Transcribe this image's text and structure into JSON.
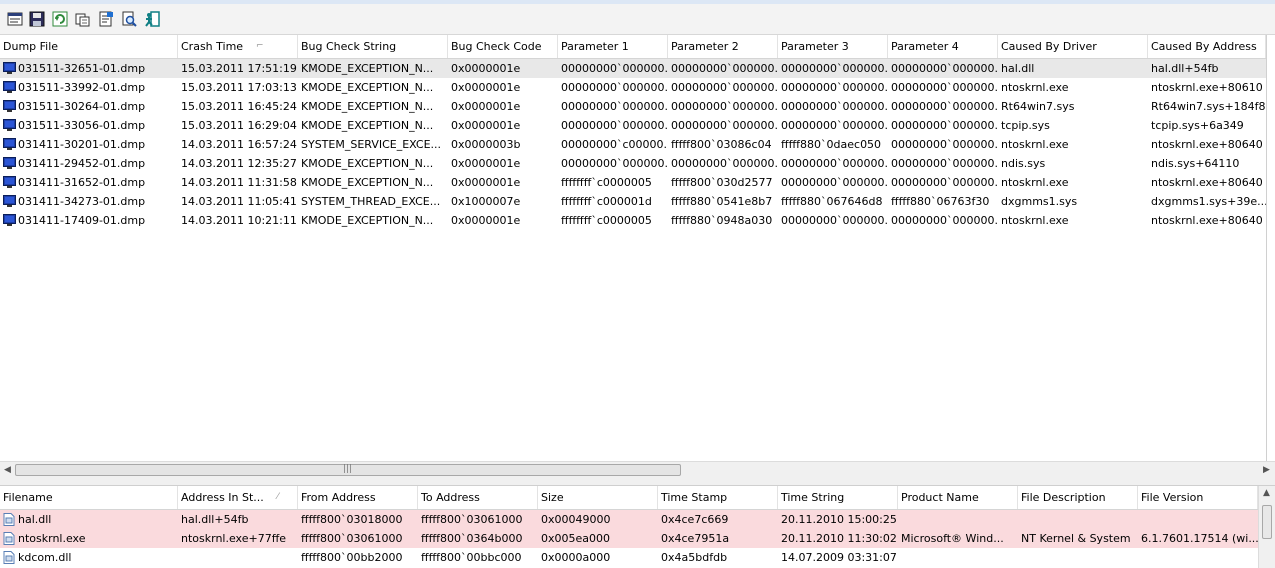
{
  "toolbar": {
    "icons": [
      "properties-icon",
      "save-icon",
      "refresh-icon",
      "copy-icon",
      "html-report-icon",
      "find-icon",
      "exit-icon"
    ]
  },
  "crash_table": {
    "columns": [
      "Dump File",
      "Crash Time",
      "Bug Check String",
      "Bug Check Code",
      "Parameter 1",
      "Parameter 2",
      "Parameter 3",
      "Parameter 4",
      "Caused By Driver",
      "Caused By Address"
    ],
    "sort_column": "Crash Time",
    "selected_row": 0,
    "rows": [
      [
        "031511-32651-01.dmp",
        "15.03.2011 17:51:19",
        "KMODE_EXCEPTION_N...",
        "0x0000001e",
        "00000000`000000...",
        "00000000`000000...",
        "00000000`000000...",
        "00000000`000000...",
        "hal.dll",
        "hal.dll+54fb"
      ],
      [
        "031511-33992-01.dmp",
        "15.03.2011 17:03:13",
        "KMODE_EXCEPTION_N...",
        "0x0000001e",
        "00000000`000000...",
        "00000000`000000...",
        "00000000`000000...",
        "00000000`000000...",
        "ntoskrnl.exe",
        "ntoskrnl.exe+80610"
      ],
      [
        "031511-30264-01.dmp",
        "15.03.2011 16:45:24",
        "KMODE_EXCEPTION_N...",
        "0x0000001e",
        "00000000`000000...",
        "00000000`000000...",
        "00000000`000000...",
        "00000000`000000...",
        "Rt64win7.sys",
        "Rt64win7.sys+184f8"
      ],
      [
        "031511-33056-01.dmp",
        "15.03.2011 16:29:04",
        "KMODE_EXCEPTION_N...",
        "0x0000001e",
        "00000000`000000...",
        "00000000`000000...",
        "00000000`000000...",
        "00000000`000000...",
        "tcpip.sys",
        "tcpip.sys+6a349"
      ],
      [
        "031411-30201-01.dmp",
        "14.03.2011 16:57:24",
        "SYSTEM_SERVICE_EXCE...",
        "0x0000003b",
        "00000000`c00000...",
        "fffff800`03086c04",
        "fffff880`0daec050",
        "00000000`000000...",
        "ntoskrnl.exe",
        "ntoskrnl.exe+80640"
      ],
      [
        "031411-29452-01.dmp",
        "14.03.2011 12:35:27",
        "KMODE_EXCEPTION_N...",
        "0x0000001e",
        "00000000`000000...",
        "00000000`000000...",
        "00000000`000000...",
        "00000000`000000...",
        "ndis.sys",
        "ndis.sys+64110"
      ],
      [
        "031411-31652-01.dmp",
        "14.03.2011 11:31:58",
        "KMODE_EXCEPTION_N...",
        "0x0000001e",
        "ffffffff`c0000005",
        "fffff800`030d2577",
        "00000000`000000...",
        "00000000`000000...",
        "ntoskrnl.exe",
        "ntoskrnl.exe+80640"
      ],
      [
        "031411-34273-01.dmp",
        "14.03.2011 11:05:41",
        "SYSTEM_THREAD_EXCE...",
        "0x1000007e",
        "ffffffff`c000001d",
        "fffff880`0541e8b7",
        "fffff880`067646d8",
        "fffff880`06763f30",
        "dxgmms1.sys",
        "dxgmms1.sys+39e..."
      ],
      [
        "031411-17409-01.dmp",
        "14.03.2011 10:21:11",
        "KMODE_EXCEPTION_N...",
        "0x0000001e",
        "ffffffff`c0000005",
        "fffff880`0948a030",
        "00000000`000000...",
        "00000000`000000...",
        "ntoskrnl.exe",
        "ntoskrnl.exe+80640"
      ]
    ]
  },
  "driver_table": {
    "columns": [
      "Filename",
      "Address In St...",
      "From Address",
      "To Address",
      "Size",
      "Time Stamp",
      "Time String",
      "Product Name",
      "File Description",
      "File Version"
    ],
    "sort_column": "Address In St...",
    "rows": [
      {
        "highlight": true,
        "cells": [
          "hal.dll",
          "hal.dll+54fb",
          "fffff800`03018000",
          "fffff800`03061000",
          "0x00049000",
          "0x4ce7c669",
          "20.11.2010 15:00:25",
          "",
          "",
          ""
        ]
      },
      {
        "highlight": true,
        "cells": [
          "ntoskrnl.exe",
          "ntoskrnl.exe+77ffe",
          "fffff800`03061000",
          "fffff800`0364b000",
          "0x005ea000",
          "0x4ce7951a",
          "20.11.2010 11:30:02",
          "Microsoft® Wind...",
          "NT Kernel & System",
          "6.1.7601.17514 (wi..."
        ]
      },
      {
        "highlight": false,
        "cells": [
          "kdcom.dll",
          "",
          "fffff800`00bb2000",
          "fffff800`00bbc000",
          "0x0000a000",
          "0x4a5bdfdb",
          "14.07.2009 03:31:07",
          "",
          "",
          ""
        ]
      }
    ]
  },
  "colors": {
    "selected_row": "#e8e8e8",
    "highlight_row": "#fadadd",
    "dump_icon": "#1f3fa8",
    "file_icon": "#5a7fb5"
  }
}
